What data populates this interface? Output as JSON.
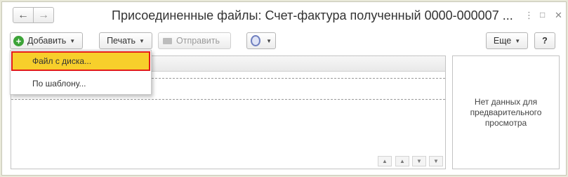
{
  "window": {
    "title": "Присоединенные файлы: Счет-фактура полученный 0000-000007 ...",
    "icons": {
      "back": "arrow-left-icon",
      "forward": "arrow-right-icon",
      "menu": "more-vertical-icon",
      "maximize": "maximize-icon",
      "close": "close-icon"
    }
  },
  "toolbar": {
    "add_label": "Добавить",
    "print_label": "Печать",
    "send_label": "Отправить",
    "more_label": "Еще",
    "help_label": "?"
  },
  "add_menu": {
    "items": [
      {
        "label": "Файл с диска..."
      },
      {
        "label": "По шаблону..."
      }
    ]
  },
  "preview": {
    "text": "Нет данных для предварительного просмотра"
  },
  "colors": {
    "highlight": "#f7cf2b",
    "highlight_border": "#e21b1b",
    "add_icon": "#3ca338"
  }
}
